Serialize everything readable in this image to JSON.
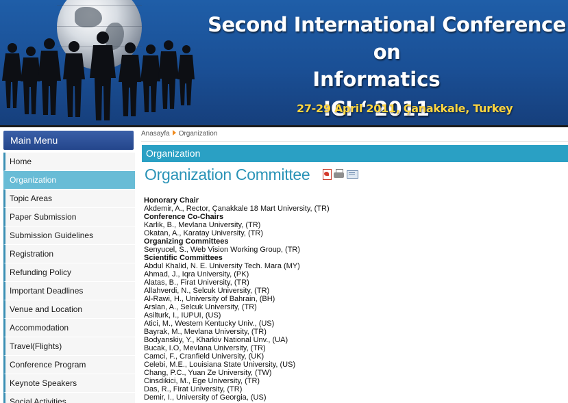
{
  "banner": {
    "title_line1": "Second International Conference on",
    "title_line2": "Informatics",
    "title_line3": "ICI ‘ 2011",
    "dates": "27-29 April 2011, Çanakkale, Turkey"
  },
  "sidebar": {
    "header": "Main Menu",
    "items": [
      {
        "label": "Home",
        "active": false
      },
      {
        "label": "Organization",
        "active": true
      },
      {
        "label": "Topic Areas",
        "active": false
      },
      {
        "label": "Paper Submission",
        "active": false
      },
      {
        "label": "Submission Guidelines",
        "active": false
      },
      {
        "label": "Registration",
        "active": false
      },
      {
        "label": "Refunding Policy",
        "active": false
      },
      {
        "label": "Important Deadlines",
        "active": false
      },
      {
        "label": "Venue and Location",
        "active": false
      },
      {
        "label": "Accommodation",
        "active": false
      },
      {
        "label": "Travel(Flights)",
        "active": false
      },
      {
        "label": "Conference Program",
        "active": false
      },
      {
        "label": "Keynote Speakers",
        "active": false
      },
      {
        "label": "Social Activities",
        "active": false
      }
    ]
  },
  "breadcrumb": {
    "home": "Anasayfa",
    "current": "Organization"
  },
  "main": {
    "section_title": "Organization",
    "page_title": "Organization Committee",
    "icons": [
      "pdf-icon",
      "print-icon",
      "email-icon"
    ]
  },
  "committee": [
    {
      "type": "heading",
      "text": "Honorary Chair"
    },
    {
      "type": "member",
      "text": "Akdemir, A., Rector, Çanakkale 18 Mart University, (TR)"
    },
    {
      "type": "heading",
      "text": "Conference Co-Chairs"
    },
    {
      "type": "member",
      "text": "Karlik, B., Mevlana University, (TR)"
    },
    {
      "type": "member",
      "text": "Okatan, A., Karatay University, (TR)"
    },
    {
      "type": "heading",
      "text": "Organizing Committees"
    },
    {
      "type": "member",
      "text": "Senyucel, S., Web Vision Working Group, (TR)"
    },
    {
      "type": "heading",
      "text": "Scientific Committees"
    },
    {
      "type": "member",
      "text": "Abdul Khalid, N. E. University Tech. Mara (MY)"
    },
    {
      "type": "member",
      "text": "Ahmad, J., Iqra University, (PK)"
    },
    {
      "type": "member",
      "text": "Alatas, B., Firat University, (TR)"
    },
    {
      "type": "member",
      "text": "Allahverdi, N., Selcuk University, (TR)"
    },
    {
      "type": "member",
      "text": "Al-Rawi, H., University of Bahrain, (BH)"
    },
    {
      "type": "member",
      "text": "Arslan, A., Selcuk University, (TR)"
    },
    {
      "type": "member",
      "text": "Asilturk, I., IUPUI, (US)"
    },
    {
      "type": "member",
      "text": "Atici, M., Western Kentucky Univ., (US)"
    },
    {
      "type": "member",
      "text": "Bayrak, M., Mevlana University, (TR)"
    },
    {
      "type": "member",
      "text": "Bodyanskiy, Y., Kharkiv National Unv., (UA)"
    },
    {
      "type": "member",
      "text": "Bucak, I.O, Mevlana University, (TR)"
    },
    {
      "type": "member",
      "text": "Camci, F., Cranfield University, (UK)"
    },
    {
      "type": "member",
      "text": "Celebi, M.E., Louisiana State University, (US)"
    },
    {
      "type": "member",
      "text": "Chang, P.C., Yuan Ze University, (TW)"
    },
    {
      "type": "member",
      "text": "Cinsdikici, M., Ege University, (TR)"
    },
    {
      "type": "member",
      "text": "Das, R., Firat University, (TR)"
    },
    {
      "type": "member",
      "text": "Demir, I., University of Georgia, (US)"
    }
  ]
}
